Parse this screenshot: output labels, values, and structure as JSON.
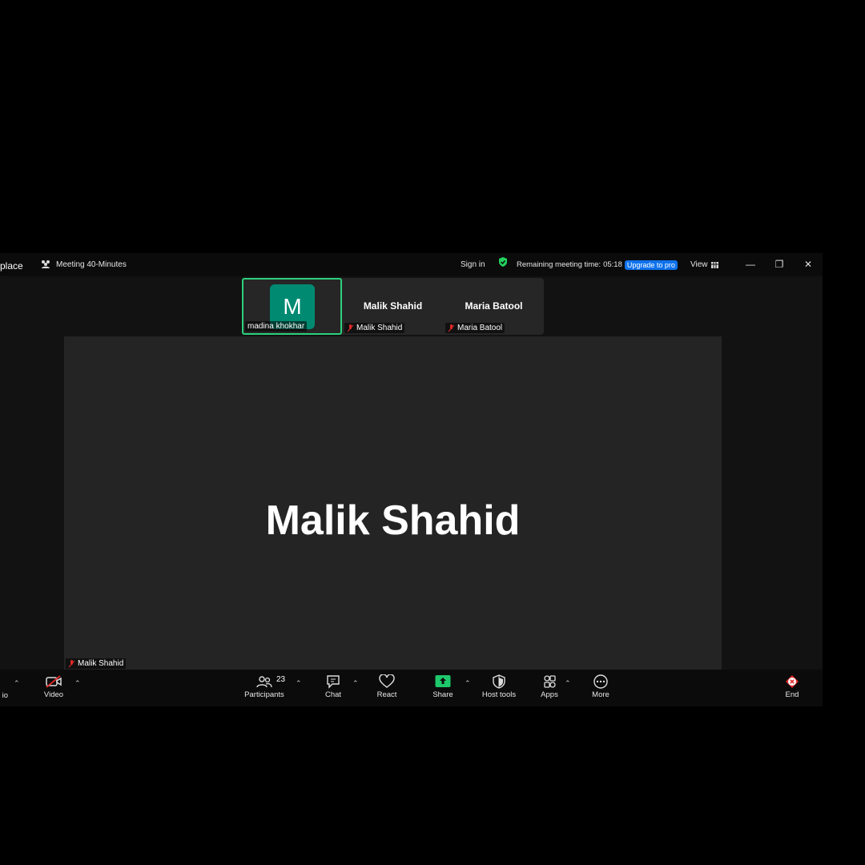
{
  "titlebar": {
    "app_fragment": "place",
    "meeting_title": "Meeting 40-Minutes",
    "sign_in": "Sign in",
    "remaining_label": "Remaining meeting time:",
    "remaining_time": "05:18",
    "upgrade": "Upgrade to pro",
    "view": "View"
  },
  "participants_strip": [
    {
      "initial": "M",
      "label": "madina khokhar",
      "active": true
    },
    {
      "name": "Malik Shahid",
      "label": "Malik Shahid",
      "muted": true
    },
    {
      "name": "Maria Batool",
      "label": "Maria Batool",
      "muted": true
    }
  ],
  "stage": {
    "name": "Malik Shahid",
    "label": "Malik Shahid"
  },
  "toolbar": {
    "audio_fragment": "io",
    "video": "Video",
    "participants": "Participants",
    "participants_count": "23",
    "chat": "Chat",
    "react": "React",
    "share": "Share",
    "host_tools": "Host tools",
    "apps": "Apps",
    "more": "More",
    "end": "End"
  },
  "colors": {
    "accent_green": "#2bd17e",
    "avatar": "#008a72",
    "upgrade_blue": "#0e72ed",
    "end_red": "#e02828",
    "share_green": "#1ec86b"
  }
}
